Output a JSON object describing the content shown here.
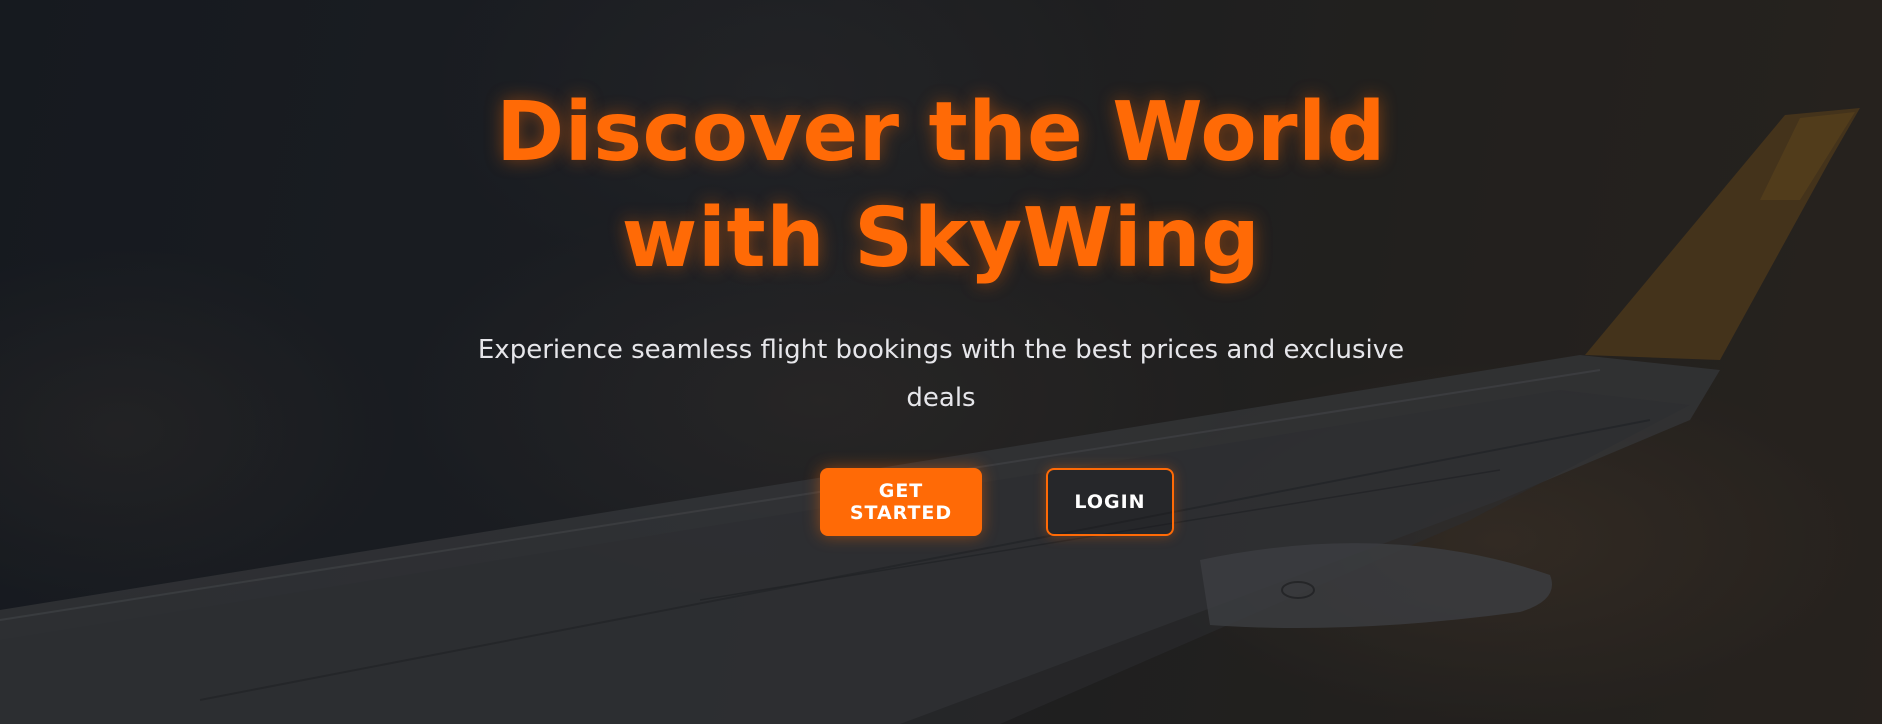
{
  "hero": {
    "title_line1": "Discover the World",
    "title_line2": "with SkyWing",
    "subtitle": "Experience seamless flight bookings with the best prices and exclusive deals"
  },
  "actions": {
    "primary_label": "GET STARTED",
    "secondary_label": "LOGIN"
  },
  "colors": {
    "accent": "#ff6a06",
    "text_light": "#e6e6ea",
    "background_dark": "#1b1f26"
  }
}
